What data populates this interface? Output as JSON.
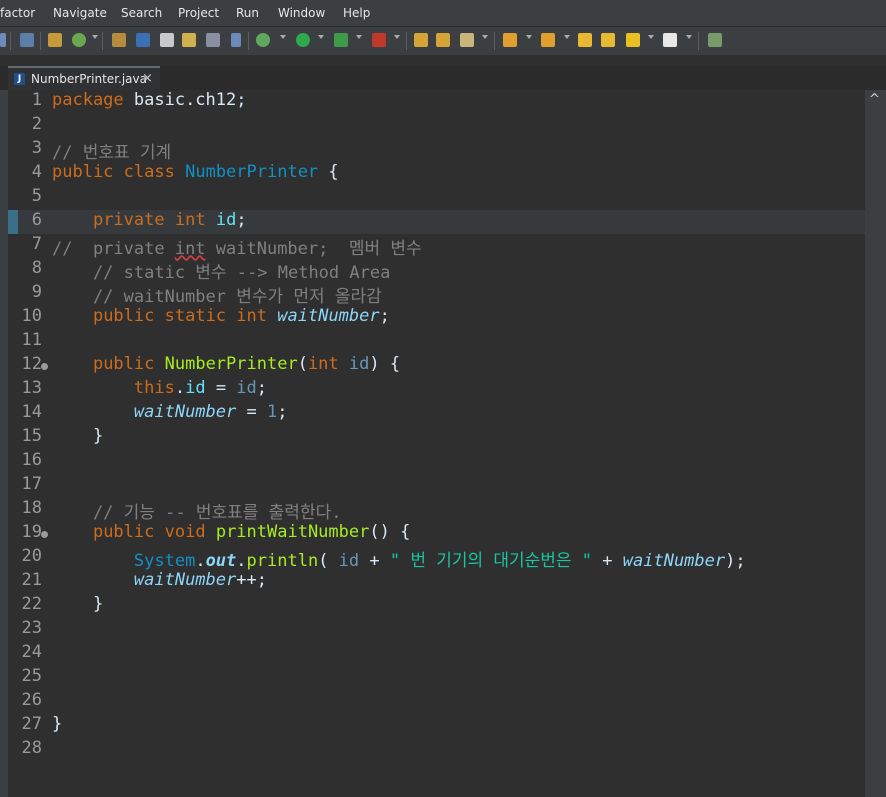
{
  "menubar": {
    "items": [
      "factor",
      "Navigate",
      "Search",
      "Project",
      "Run",
      "Window",
      "Help"
    ]
  },
  "editor_tab": {
    "title": "NumberPrinter.java",
    "close": "×",
    "icon": "J"
  },
  "scrollbar": {
    "up_arrow": "^"
  },
  "line_numbers": [
    "1",
    "2",
    "3",
    "4",
    "5",
    "6",
    "7",
    "8",
    "9",
    "10",
    "11",
    "12",
    "13",
    "14",
    "15",
    "16",
    "17",
    "18",
    "19",
    "20",
    "21",
    "22",
    "23",
    "24",
    "25",
    "26",
    "27",
    "28"
  ],
  "code": {
    "l1": {
      "kw": "package",
      "rest": " basic.ch12;"
    },
    "l3": {
      "comment": "// 번호표 기계"
    },
    "l4": {
      "kw1": "public",
      "kw2": "class",
      "cls": "NumberPrinter",
      "rest": " {"
    },
    "l6": {
      "indent": "    ",
      "kw1": "private",
      "kw2": "int",
      "fld": "id",
      "semi": ";"
    },
    "l7": {
      "c1": "//  private ",
      "c2": "int",
      "c3": " waitNumber;  멤버 변수"
    },
    "l8": {
      "text": "    // static 변수 --> Method Area"
    },
    "l9": {
      "text": "    // waitNumber 변수가 먼저 올라감"
    },
    "l10": {
      "indent": "    ",
      "kw1": "public",
      "kw2": "static",
      "kw3": "int",
      "fld": "waitNumber",
      "semi": ";"
    },
    "l12": {
      "indent": "    ",
      "kw1": "public",
      "mth": "NumberPrinter",
      "open": "(",
      "kw2": "int",
      "param": "id",
      "close": ") {"
    },
    "l13": {
      "indent": "        ",
      "kw": "this",
      "dot": ".",
      "fld": "id",
      "eq": " = ",
      "param": "id",
      "semi": ";"
    },
    "l14": {
      "indent": "        ",
      "fld": "waitNumber",
      "eq": " = ",
      "num": "1",
      "semi": ";"
    },
    "l15": {
      "text": "    }"
    },
    "l18": {
      "text": "    // 기능 -- 번호표를 출력한다."
    },
    "l19": {
      "indent": "    ",
      "kw1": "public",
      "kw2": "void",
      "mth": "printWaitNumber",
      "rest": "() {"
    },
    "l20": {
      "indent": "        ",
      "cls": "System",
      "dot1": ".",
      "out": "out",
      "dot2": ".",
      "mth": "println",
      "open": "( ",
      "param": "id",
      "plus1": " + ",
      "str": "\" 번 기기의 대기순번은 \"",
      "plus2": " + ",
      "fld": "waitNumber",
      "close": ");"
    },
    "l21": {
      "indent": "        ",
      "fld": "waitNumber",
      "rest": "++;"
    },
    "l22": {
      "text": "    }"
    },
    "l27": {
      "text": "}"
    }
  }
}
